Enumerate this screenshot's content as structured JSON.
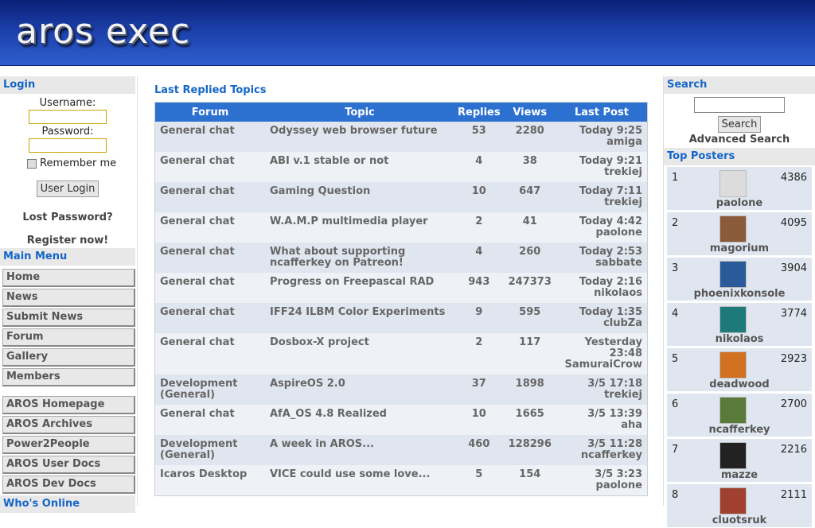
{
  "header": {
    "logo_text": "aros exec"
  },
  "login": {
    "title": "Login",
    "username_label": "Username:",
    "password_label": "Password:",
    "remember_label": "Remember me",
    "login_button": "User Login",
    "lost_password": "Lost Password?",
    "register": "Register now!"
  },
  "main_menu": {
    "title": "Main Menu",
    "items": [
      "Home",
      "News",
      "Submit News",
      "Forum",
      "Gallery",
      "Members"
    ]
  },
  "links_menu": {
    "items": [
      "AROS Homepage",
      "AROS Archives",
      "Power2People",
      "AROS User Docs",
      "AROS Dev Docs"
    ]
  },
  "whos_online": {
    "title": "Who's Online"
  },
  "topics": {
    "title": "Last Replied Topics",
    "columns": [
      "Forum",
      "Topic",
      "Replies",
      "Views",
      "Last Post"
    ],
    "rows": [
      {
        "forum": "General chat",
        "topic": "Odyssey web browser future",
        "replies": "53",
        "views": "2280",
        "time": "Today 9:25",
        "user": "amiga"
      },
      {
        "forum": "General chat",
        "topic": "ABI v.1 stable or not",
        "replies": "4",
        "views": "38",
        "time": "Today 9:21",
        "user": "trekiej"
      },
      {
        "forum": "General chat",
        "topic": "Gaming Question",
        "replies": "10",
        "views": "647",
        "time": "Today 7:11",
        "user": "trekiej"
      },
      {
        "forum": "General chat",
        "topic": "W.A.M.P multimedia player",
        "replies": "2",
        "views": "41",
        "time": "Today 4:42",
        "user": "paolone"
      },
      {
        "forum": "General chat",
        "topic": "What about supporting ncafferkey on Patreon!",
        "replies": "4",
        "views": "260",
        "time": "Today 2:53",
        "user": "sabbate"
      },
      {
        "forum": "General chat",
        "topic": "Progress on Freepascal RAD",
        "replies": "943",
        "views": "247373",
        "time": "Today 2:16",
        "user": "nikolaos"
      },
      {
        "forum": "General chat",
        "topic": "IFF24 ILBM Color Experiments",
        "replies": "9",
        "views": "595",
        "time": "Today 1:35",
        "user": "clubZa"
      },
      {
        "forum": "General chat",
        "topic": "Dosbox-X project",
        "replies": "2",
        "views": "117",
        "time": "Yesterday 23:48",
        "user": "SamuraiCrow"
      },
      {
        "forum": "Development (General)",
        "topic": "AspireOS 2.0",
        "replies": "37",
        "views": "1898",
        "time": "3/5 17:18",
        "user": "trekiej"
      },
      {
        "forum": "General chat",
        "topic": "AfA_OS 4.8 Realized",
        "replies": "10",
        "views": "1665",
        "time": "3/5 13:39",
        "user": "aha"
      },
      {
        "forum": "Development (General)",
        "topic": "A week in AROS...",
        "replies": "460",
        "views": "128296",
        "time": "3/5 11:28",
        "user": "ncafferkey"
      },
      {
        "forum": "Icaros Desktop",
        "topic": "VICE could use some love...",
        "replies": "5",
        "views": "154",
        "time": "3/5 3:23",
        "user": "paolone"
      }
    ]
  },
  "search": {
    "title": "Search",
    "button": "Search",
    "advanced": "Advanced Search"
  },
  "top_posters": {
    "title": "Top Posters",
    "items": [
      {
        "rank": "1",
        "name": "paolone",
        "count": "4386",
        "avatar_color": "#dcdcdc"
      },
      {
        "rank": "2",
        "name": "magorium",
        "count": "4095",
        "avatar_color": "#8a5a3a"
      },
      {
        "rank": "3",
        "name": "phoenixkonsole",
        "count": "3904",
        "avatar_color": "#2a5a9a"
      },
      {
        "rank": "4",
        "name": "nikolaos",
        "count": "3774",
        "avatar_color": "#1e7a7a"
      },
      {
        "rank": "5",
        "name": "deadwood",
        "count": "2923",
        "avatar_color": "#d07020"
      },
      {
        "rank": "6",
        "name": "ncafferkey",
        "count": "2700",
        "avatar_color": "#5a7a3a"
      },
      {
        "rank": "7",
        "name": "mazze",
        "count": "2216",
        "avatar_color": "#222222"
      },
      {
        "rank": "8",
        "name": "cluotsruk",
        "count": "2111",
        "avatar_color": "#a04030"
      }
    ]
  }
}
